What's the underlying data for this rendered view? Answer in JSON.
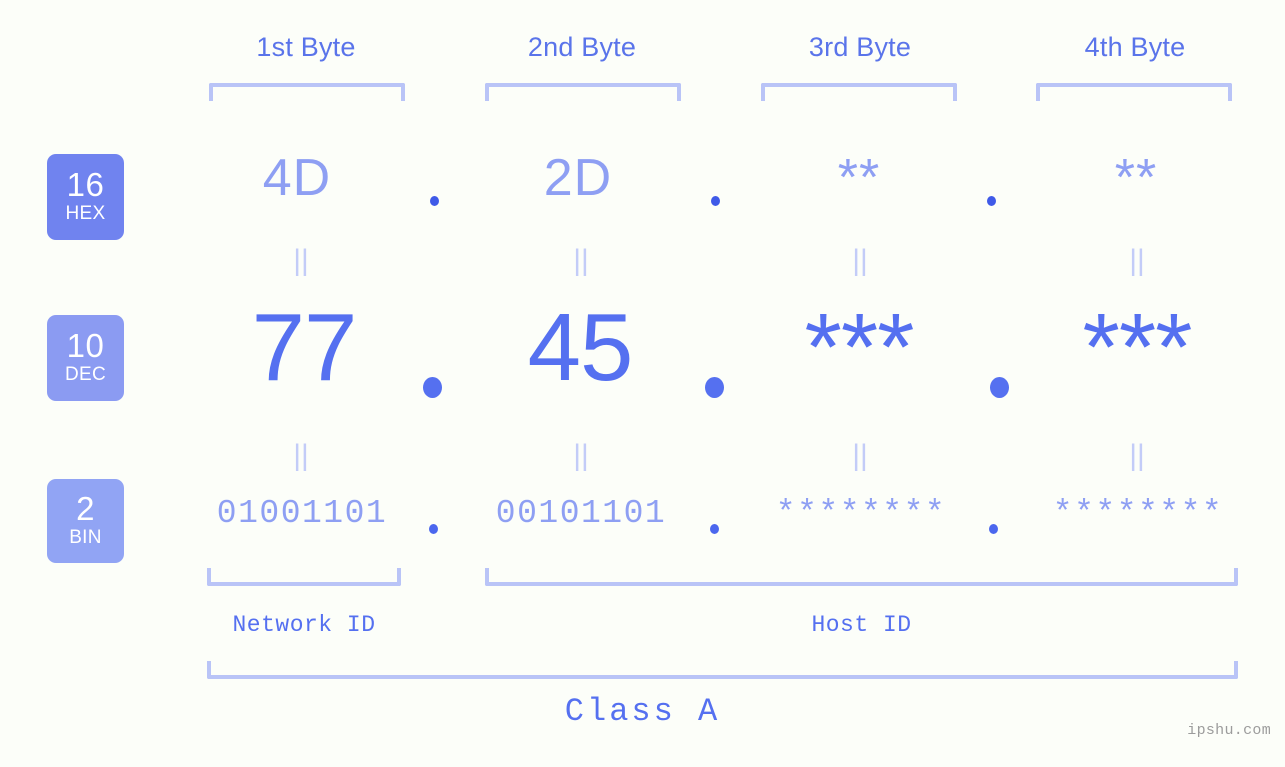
{
  "meta": {
    "background_color": "#fcfef9",
    "accent_strong": "#5570f0",
    "accent_mid": "#8e9ff3",
    "accent_light": "#b9c4f7",
    "watermark": "ipshu.com"
  },
  "header": {
    "byte_labels": [
      "1st Byte",
      "2nd Byte",
      "3rd Byte",
      "4th Byte"
    ]
  },
  "bases": [
    {
      "number": "16",
      "name": "HEX",
      "color": "#7083ef"
    },
    {
      "number": "10",
      "name": "DEC",
      "color": "#8b9bf2"
    },
    {
      "number": "2",
      "name": "BIN",
      "color": "#91a4f4"
    }
  ],
  "rows": {
    "hex": {
      "values": [
        "4D",
        "2D",
        "**",
        "**"
      ],
      "separator": "."
    },
    "dec": {
      "values": [
        "77",
        "45",
        "***",
        "***"
      ],
      "separator": "."
    },
    "bin": {
      "values": [
        "01001101",
        "00101101",
        "********",
        "********"
      ],
      "separator": "."
    }
  },
  "equals_symbol": "||",
  "footer": {
    "network_id_label": "Network ID",
    "host_id_label": "Host ID",
    "class_label": "Class A"
  }
}
